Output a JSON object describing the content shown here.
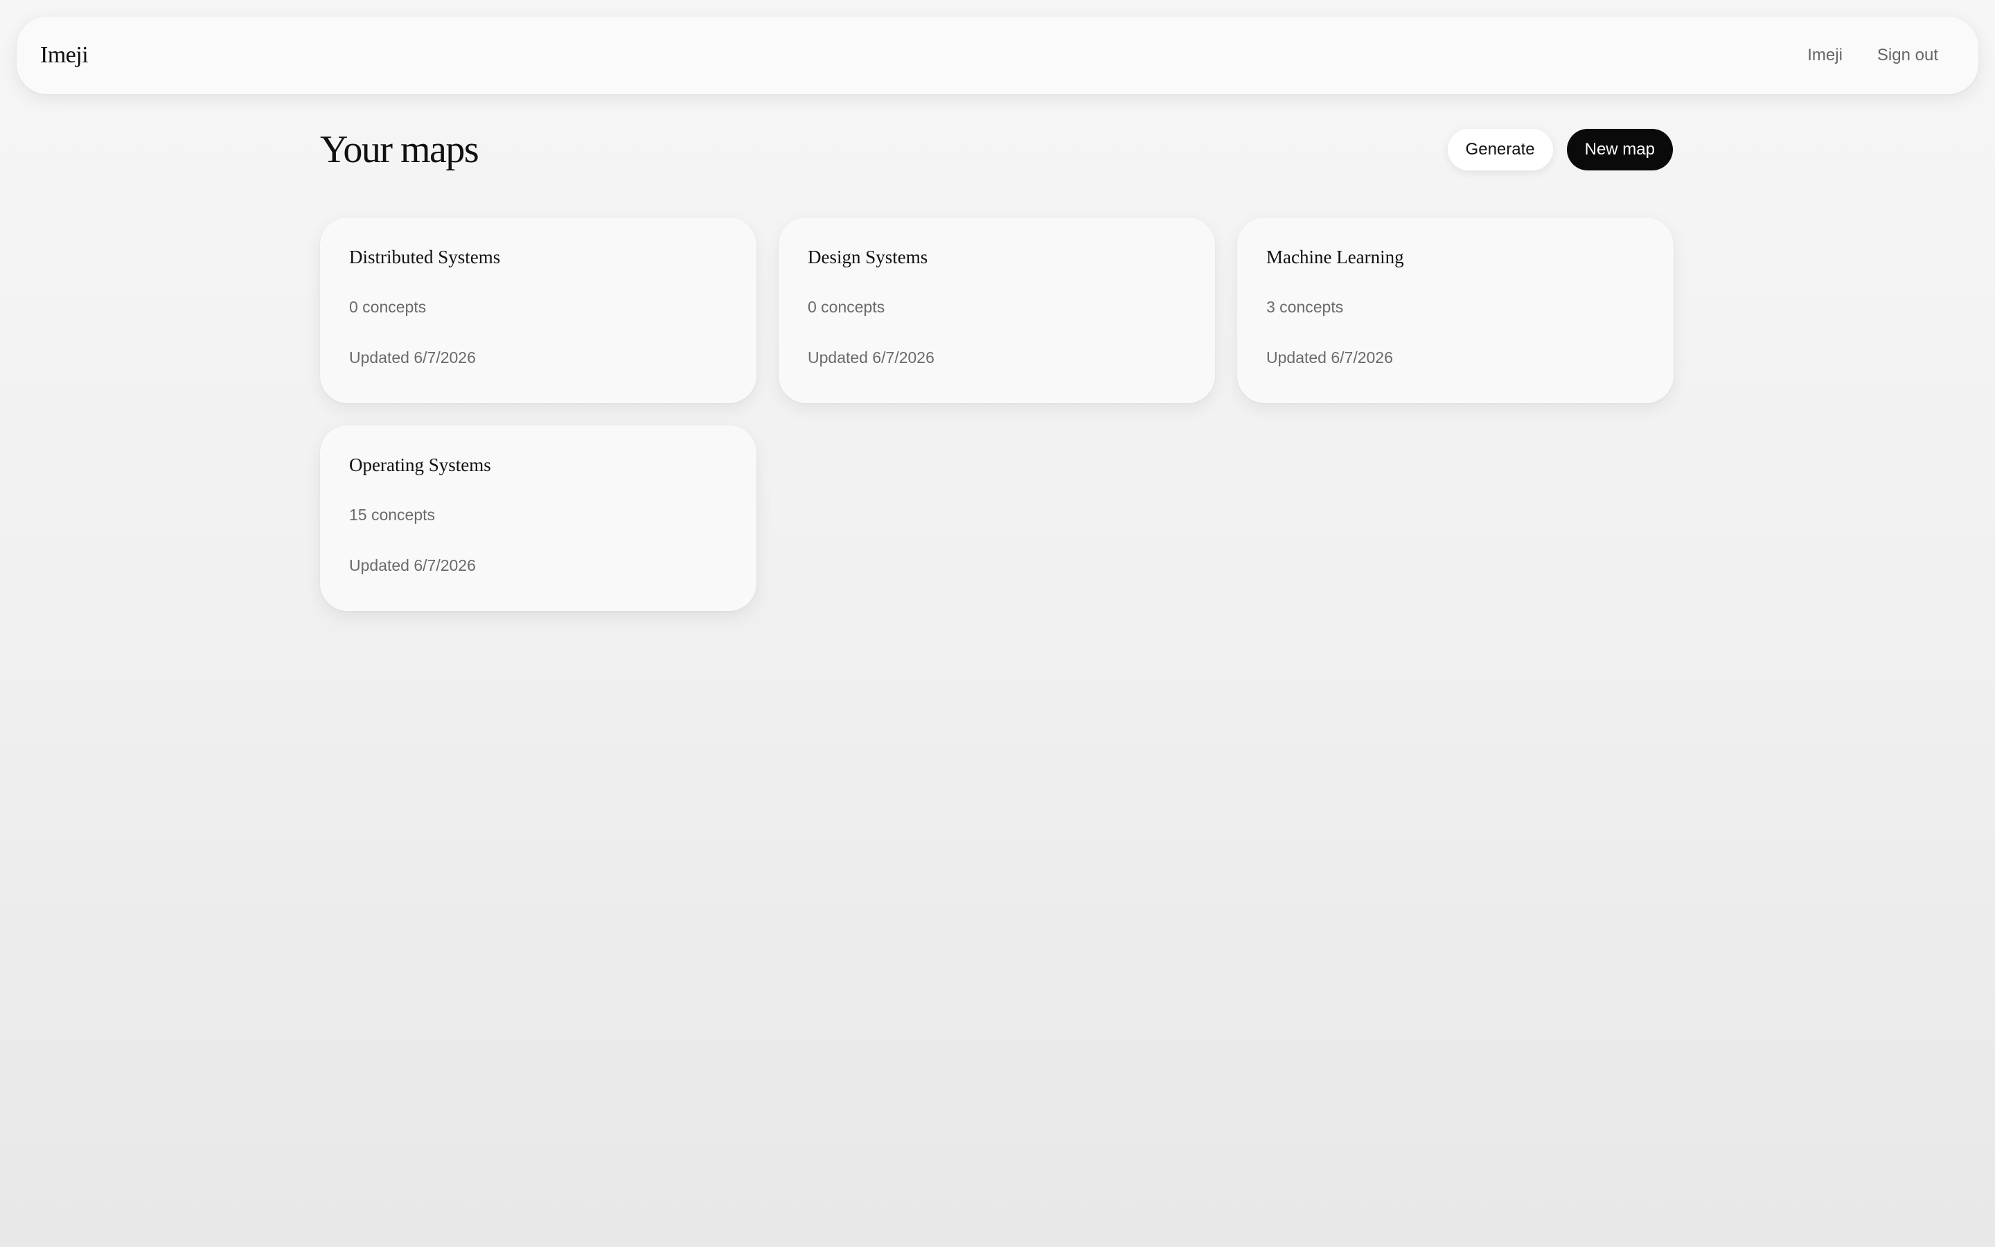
{
  "header": {
    "brand": "Imeji",
    "nav": {
      "home_link": "Imeji",
      "sign_out": "Sign out"
    }
  },
  "main": {
    "title": "Your maps",
    "actions": {
      "generate": "Generate",
      "new_map": "New map"
    },
    "maps": [
      {
        "title": "Distributed Systems",
        "count": "0 concepts",
        "updated": "Updated 6/7/2026"
      },
      {
        "title": "Design Systems",
        "count": "0 concepts",
        "updated": "Updated 6/7/2026"
      },
      {
        "title": "Machine Learning",
        "count": "3 concepts",
        "updated": "Updated 6/7/2026"
      },
      {
        "title": "Operating Systems",
        "count": "15 concepts",
        "updated": "Updated 6/7/2026"
      }
    ]
  },
  "colors": {
    "primary_button": "#0a0a0a",
    "card_background": "#f9f9f9"
  }
}
